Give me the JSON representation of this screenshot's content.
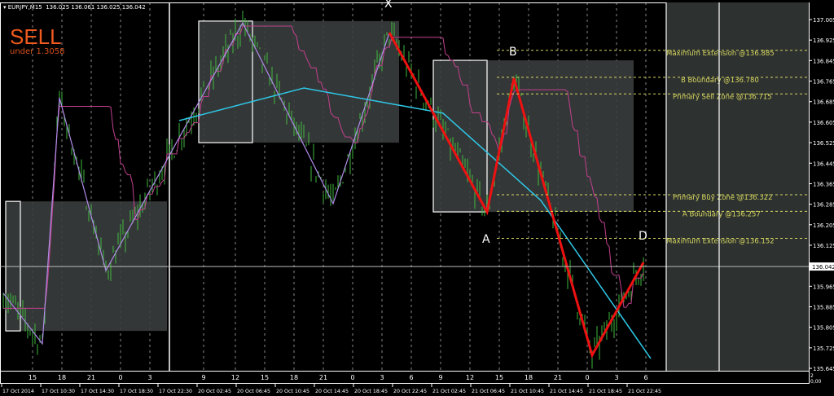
{
  "header": {
    "symbol": "EURJPY,M15",
    "ohlc": "136.025 136.061 136.025 136.042"
  },
  "signal": {
    "title": "SELL",
    "subtitle": "under 1.3058"
  },
  "colors": {
    "candle": "#3fb83f",
    "purple": "#b08be8",
    "red": "#ee1111",
    "cyan": "#2ec8e8",
    "pink": "#c2408f",
    "level": "#d8d860",
    "box": "#3a3d3d"
  },
  "chart_data": {
    "type": "candlestick",
    "symbol": "EURJPY",
    "timeframe": "M15",
    "ylim": [
      135.62,
      137.06
    ],
    "y_ticks": [
      "137.005",
      "136.925",
      "136.845",
      "136.765",
      "136.685",
      "136.605",
      "136.525",
      "136.445",
      "136.365",
      "136.285",
      "136.205",
      "136.125",
      "135.965",
      "135.885",
      "135.805",
      "135.725",
      "135.645"
    ],
    "current_price": "136.042",
    "x_hour_ticks": [
      {
        "bar": 12,
        "label": "15"
      },
      {
        "bar": 24,
        "label": "18"
      },
      {
        "bar": 36,
        "label": "21"
      },
      {
        "bar": 48,
        "label": "0"
      },
      {
        "bar": 60,
        "label": "3"
      },
      {
        "bar": 82,
        "label": "9"
      },
      {
        "bar": 95,
        "label": "12"
      },
      {
        "bar": 107,
        "label": "15"
      },
      {
        "bar": 119,
        "label": "18"
      },
      {
        "bar": 131,
        "label": "21"
      },
      {
        "bar": 143,
        "label": "0"
      },
      {
        "bar": 155,
        "label": "3"
      },
      {
        "bar": 167,
        "label": "6"
      },
      {
        "bar": 179,
        "label": "9"
      },
      {
        "bar": 191,
        "label": "12"
      },
      {
        "bar": 203,
        "label": "15"
      },
      {
        "bar": 215,
        "label": "18"
      },
      {
        "bar": 227,
        "label": "21"
      },
      {
        "bar": 239,
        "label": "0"
      },
      {
        "bar": 251,
        "label": "3"
      },
      {
        "bar": 263,
        "label": "6"
      }
    ],
    "x_date_ticks": [
      "17 Oct 2014",
      "17 Oct 10:30",
      "17 Oct 14:30",
      "17 Oct 18:30",
      "17 Oct 22:30",
      "20 Oct 02:45",
      "20 Oct 06:45",
      "20 Oct 10:45",
      "20 Oct 14:45",
      "20 Oct 18:45",
      "20 Oct 22:45",
      "21 Oct 02:45",
      "21 Oct 06:45",
      "21 Oct 10:45",
      "21 Oct 14:45",
      "21 Oct 18:45",
      "21 Oct 22:45"
    ],
    "purple_zigzag": [
      [
        0,
        135.938
      ],
      [
        16,
        135.741
      ],
      [
        23,
        136.7
      ],
      [
        42,
        136.026
      ],
      [
        69,
        136.493
      ],
      [
        98,
        136.992
      ],
      [
        135,
        136.287
      ],
      [
        158,
        136.954
      ]
    ],
    "harmonic_pattern": {
      "points": [
        {
          "label": "X",
          "bar": 158,
          "price": 136.954
        },
        {
          "label": "A",
          "bar": 198,
          "price": 136.255
        },
        {
          "label": "B",
          "bar": 209,
          "price": 136.776
        },
        {
          "label": "",
          "bar": 241,
          "price": 135.696
        },
        {
          "label": "D",
          "bar": 262,
          "price": 136.058
        }
      ]
    },
    "cyan_curve": [
      [
        72,
        136.611
      ],
      [
        123,
        136.738
      ],
      [
        180,
        136.64
      ],
      [
        220,
        136.3
      ],
      [
        265,
        135.683
      ]
    ],
    "zones": [
      {
        "from": 1,
        "to": 67,
        "top": 136.296,
        "bottom": 135.791,
        "bordered_until": 7
      },
      {
        "from": 80,
        "to": 162,
        "top": 136.999,
        "bottom": 136.525,
        "bordered_until": 102
      },
      {
        "from": 176,
        "to": 258,
        "top": 136.846,
        "bottom": 136.255,
        "bordered_until": 198
      }
    ],
    "levels": [
      {
        "label": "Maximum Extension @136.885",
        "price": 136.885
      },
      {
        "label": "B Boundary @136.780",
        "price": 136.78
      },
      {
        "label": "Primary Sell Zone @136.715",
        "price": 136.715
      },
      {
        "label": "Primary Buy Zone @136.322",
        "price": 136.322
      },
      {
        "label": "A Boundary @136.257",
        "price": 136.257
      },
      {
        "label": "Maximum Extension @136.152",
        "price": 136.152
      }
    ],
    "indicator_label": "0,00",
    "indicator_top": "2"
  }
}
